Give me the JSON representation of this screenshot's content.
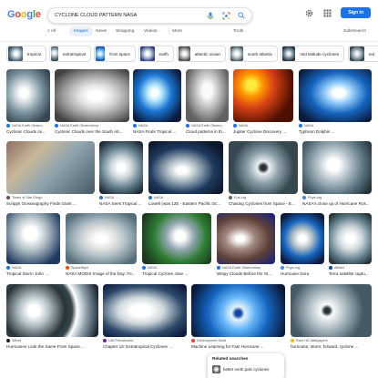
{
  "header": {
    "logo_letters": [
      "G",
      "o",
      "o",
      "g",
      "l",
      "e"
    ],
    "logo_colors": [
      "#4285f4",
      "#ea4335",
      "#fbbc05",
      "#4285f4",
      "#34a853",
      "#ea4335"
    ],
    "query": "CYCLONE CLOUD PATTERN NASA",
    "signin_label": "Sign in"
  },
  "tabs": {
    "all": "All",
    "images": "Images",
    "news": "News",
    "shopping": "Shopping",
    "videos": "Videos",
    "more": "More",
    "tools": "Tools",
    "safesearch": "SafeSearch"
  },
  "chips": [
    "tropical",
    "extratropical",
    "from space",
    "earth",
    "atlantic ocean",
    "south atlantic",
    "mid latitude cyclones",
    "ext"
  ],
  "results": [
    {
      "source": "NASA Earth Observ...",
      "title": "Cyclonic Clouds ov..."
    },
    {
      "source": "NASA Earth Observatory",
      "title": "Cyclonic Clouds over the South Atl..."
    },
    {
      "source": "NASA",
      "title": "NASA Finds Tropical ..."
    },
    {
      "source": "NASA Earth Observ...",
      "title": "Cloud patterns in th..."
    },
    {
      "source": "NASA",
      "title": "Jupiter Cyclone Discovery ..."
    },
    {
      "source": "NASA",
      "title": "Typhoon Dolphin ..."
    },
    {
      "source": "Times of San Diego",
      "title": "Scripps Oceanography Finds Giant ..."
    },
    {
      "source": "NASA",
      "title": "NASA Sees Tropical ..."
    },
    {
      "source": "NASA",
      "title": "Lowell (was 12E - Eastern Pacific Oc..."
    },
    {
      "source": "Eos.org",
      "title": "Chasing Cyclones from Space - E..."
    },
    {
      "source": "Phys.org",
      "title": "NASA's close up of Hurricane Ros..."
    },
    {
      "source": "NASA",
      "title": "Tropical Storm John ..."
    },
    {
      "source": "Spaceflight",
      "title": "NASA MODIS Image of the Day: Fe..."
    },
    {
      "source": "NASA",
      "title": "Tropical Cyclone Jose ..."
    },
    {
      "source": "NASA Earth Observatory",
      "title": "Wispy Clouds Before the St..."
    },
    {
      "source": "Phys.org",
      "title": "Hurricane Dora"
    },
    {
      "source": "Allianz",
      "title": "Terra satellite captu..."
    },
    {
      "source": "Wired",
      "title": "Hurricanes Look the Same From Space ..."
    },
    {
      "source": "UW Pressbooks",
      "title": "Chapter 13: Extratropical Cyclones ..."
    },
    {
      "source": "Development Seed",
      "title": "Machine Learning for Fast Hurricane ..."
    },
    {
      "source": "Rare HD Wallpapers",
      "title": "hurricane, storm, forward, cyclone ..."
    }
  ],
  "related": {
    "title": "Related searches",
    "item": "better north pole cyclones"
  },
  "colors": {
    "accent": "#1a73e8",
    "active_tab_bg": "#e8f0fe"
  }
}
